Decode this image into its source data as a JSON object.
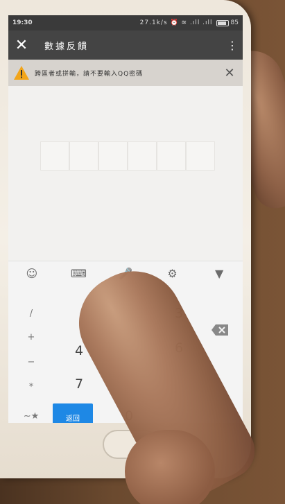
{
  "status_bar": {
    "time": "19:30",
    "icons": "27.1k/s ⏰ ≋ .ıll .ıll",
    "battery": "85"
  },
  "app_bar": {
    "title": "數據反饋",
    "close_glyph": "✕",
    "more_glyph": "⋮"
  },
  "warning": {
    "text": "跨區者或拼輸，請不要輸入QQ密碼",
    "close_glyph": "✕"
  },
  "keyboard": {
    "toolbar": [
      {
        "name": "emoji-icon",
        "glyph": "☺"
      },
      {
        "name": "keyboard-icon",
        "glyph": "⌨"
      },
      {
        "name": "microphone-icon",
        "glyph": "🎤"
      },
      {
        "name": "settings-icon",
        "glyph": "⚙"
      },
      {
        "name": "collapse-icon",
        "glyph": "▼"
      }
    ],
    "symbols": {
      "slash": "/",
      "plus": "+",
      "minus": "−",
      "star": "*",
      "tilde_star": "~★"
    },
    "digits": {
      "d3": "3",
      "d4": "4",
      "d6": "6",
      "d7": "7",
      "d0": "0"
    },
    "return_label": "返回"
  },
  "colors": {
    "accent": "#1e88e5",
    "app_bar": "#444444",
    "warning_bg": "#d7d3ce"
  }
}
